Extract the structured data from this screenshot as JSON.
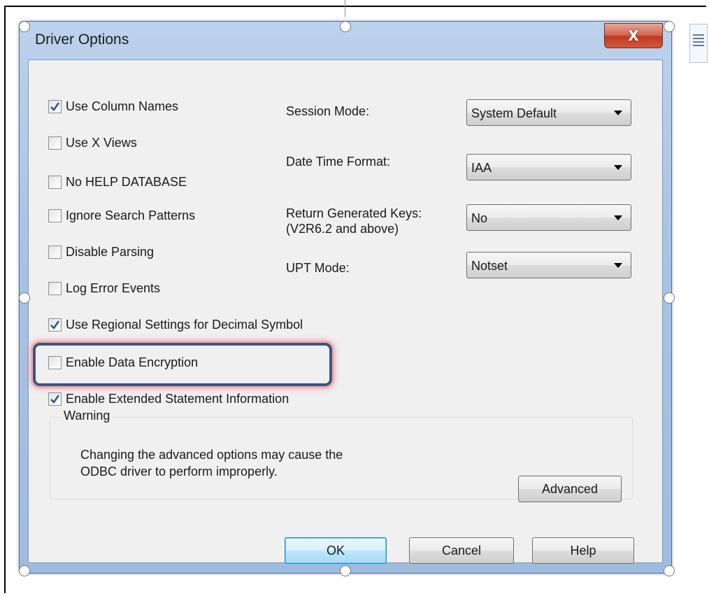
{
  "dialog": {
    "title": "Driver Options",
    "close_label": "X"
  },
  "checkboxes": [
    {
      "label": "Use Column Names",
      "checked": true
    },
    {
      "label": "Use X Views",
      "checked": false
    },
    {
      "label": "No HELP DATABASE",
      "checked": false
    },
    {
      "label": "Ignore Search Patterns",
      "checked": false
    },
    {
      "label": "Disable Parsing",
      "checked": false
    },
    {
      "label": "Log Error Events",
      "checked": false
    },
    {
      "label": "Use Regional Settings for Decimal Symbol",
      "checked": true
    },
    {
      "label": "Enable Data Encryption",
      "checked": false
    },
    {
      "label": "Enable Extended Statement Information",
      "checked": true
    }
  ],
  "settings": {
    "session_mode": {
      "label": "Session Mode:",
      "value": "System Default"
    },
    "date_time_format": {
      "label": "Date Time Format:",
      "value": "IAA"
    },
    "return_generated_keys": {
      "label_line1": "Return Generated Keys:",
      "label_line2": "(V2R6.2 and above)",
      "value": "No"
    },
    "upt_mode": {
      "label": "UPT Mode:",
      "value": "Notset"
    }
  },
  "warning": {
    "legend": "Warning",
    "line1": "Changing the advanced options may cause the",
    "line2": "ODBC driver to perform improperly.",
    "advanced_label": "Advanced"
  },
  "buttons": {
    "ok": "OK",
    "cancel": "Cancel",
    "help": "Help"
  },
  "colors": {
    "highlight_border": "#3a5680",
    "highlight_glow": "#f3a8b0",
    "close_button": "#c0391f"
  }
}
